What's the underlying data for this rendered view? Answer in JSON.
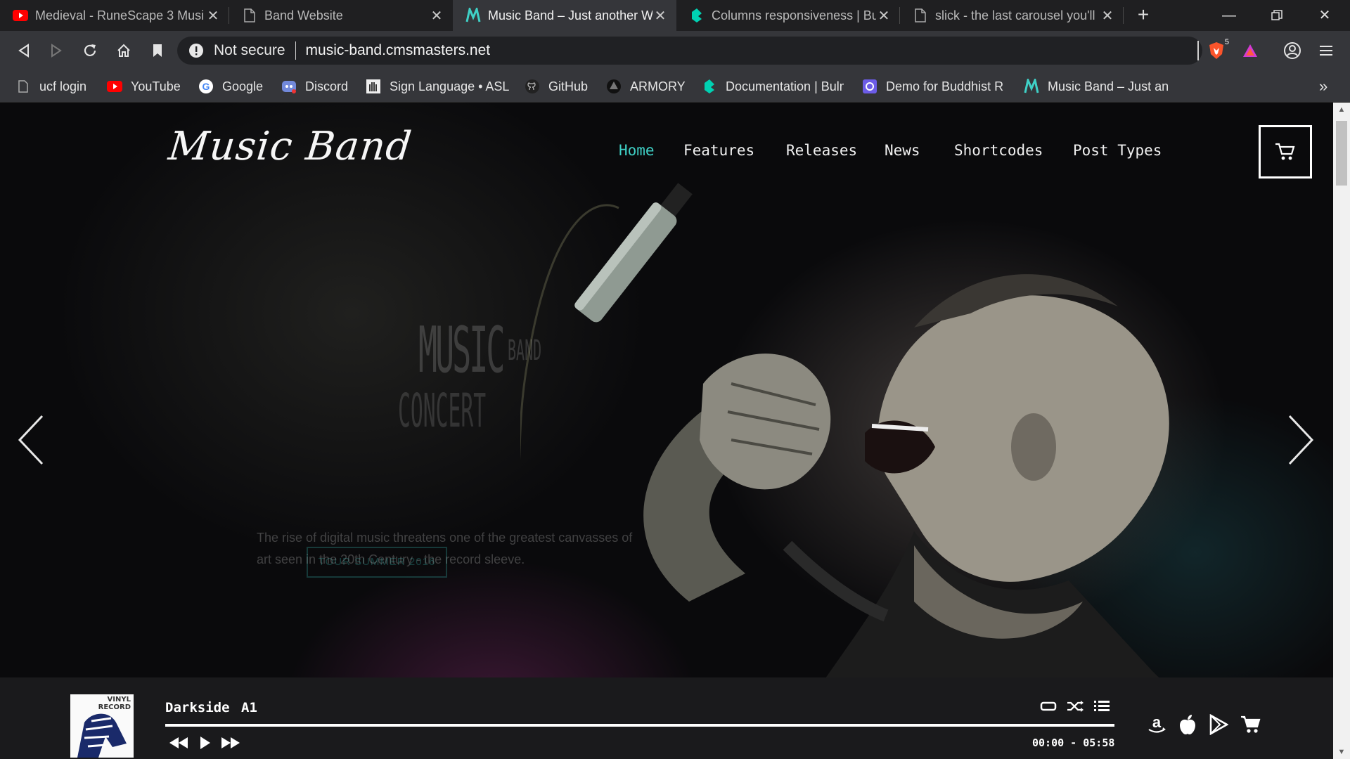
{
  "browser": {
    "tabs": [
      {
        "title": "Medieval - RuneScape 3 Musi",
        "icon": "youtube-icon"
      },
      {
        "title": "Band Website",
        "icon": "page-icon"
      },
      {
        "title": "Music Band – Just another W",
        "icon": "music-band-icon"
      },
      {
        "title": "Columns responsiveness | Bul",
        "icon": "bulma-icon"
      },
      {
        "title": "slick - the last carousel you'll",
        "icon": "page-icon"
      }
    ],
    "new_tab_label": "+",
    "address": {
      "security": "Not secure",
      "url": "music-band.cmsmasters.net"
    },
    "brave_badge": "5",
    "bookmarks": [
      {
        "label": "ucf login",
        "icon": "page-icon"
      },
      {
        "label": "YouTube",
        "icon": "youtube-icon"
      },
      {
        "label": "Google",
        "icon": "google-icon"
      },
      {
        "label": "Discord",
        "icon": "discord-icon"
      },
      {
        "label": "Sign Language • ASL",
        "icon": "asl-icon"
      },
      {
        "label": "GitHub",
        "icon": "github-icon"
      },
      {
        "label": "ARMORY",
        "icon": "armory-icon"
      },
      {
        "label": "Documentation | Bulm",
        "icon": "bulma-icon"
      },
      {
        "label": "Demo for Buddhist R",
        "icon": "buddhist-icon"
      },
      {
        "label": "Music Band – Just an",
        "icon": "music-band-icon"
      }
    ],
    "more_bookmarks": "»"
  },
  "site": {
    "logo": "Music Band",
    "nav": [
      "Home",
      "Features",
      "Releases",
      "News",
      "Shortcodes",
      "Post Types"
    ],
    "active_nav": "Home",
    "accent_color": "#3fd0c6"
  },
  "slider": {
    "title_main": "MUSIC",
    "title_side": "BAND",
    "title_sub": "CONCERT",
    "description": "The rise of digital music threatens one of the greatest canvasses of art seen in the 20th Century - the record sleeve.",
    "button": "TOUR SUMMER 2016"
  },
  "player": {
    "album_label_line1": "VINYL",
    "album_label_line2": "RECORD",
    "track_title": "Darkside",
    "track_code": "A1",
    "time": "00:00 - 05:58",
    "progress": 0
  }
}
